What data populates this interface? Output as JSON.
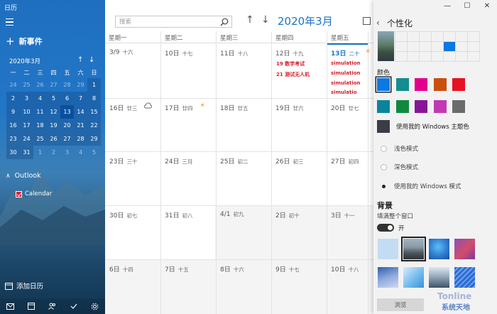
{
  "app": {
    "title": "日历"
  },
  "sidebar": {
    "new_event": "新事件",
    "mini": {
      "month_label": "2020年3月",
      "weekdays": [
        "一",
        "二",
        "三",
        "四",
        "五",
        "六",
        "日"
      ],
      "days": [
        "24",
        "25",
        "26",
        "27",
        "28",
        "29",
        "1",
        "2",
        "3",
        "4",
        "5",
        "6",
        "7",
        "8",
        "9",
        "10",
        "11",
        "12",
        "13",
        "14",
        "15",
        "16",
        "17",
        "18",
        "19",
        "20",
        "21",
        "22",
        "23",
        "24",
        "25",
        "26",
        "27",
        "28",
        "29",
        "30",
        "31",
        "1",
        "2",
        "3",
        "4",
        "5"
      ]
    },
    "outlook_label": "Outlook",
    "calendar_item": "Calendar",
    "add_calendar": "添加日历"
  },
  "toolbar": {
    "search_placeholder": "搜索",
    "month_title": "2020年3月"
  },
  "calendar": {
    "weekdays": [
      "星期一",
      "星期二",
      "星期三",
      "星期四",
      "星期五"
    ],
    "rows": [
      [
        {
          "d": "3/9",
          "l": "十六"
        },
        {
          "d": "10日",
          "l": "十七"
        },
        {
          "d": "11日",
          "l": "十八"
        },
        {
          "d": "12日",
          "l": "十九"
        },
        {
          "d": "13日",
          "l": "二十"
        }
      ],
      [
        {
          "d": "16日",
          "l": "廿三"
        },
        {
          "d": "17日",
          "l": "廿四"
        },
        {
          "d": "18日",
          "l": "廿五"
        },
        {
          "d": "19日",
          "l": "廿六"
        },
        {
          "d": "20日",
          "l": "廿七"
        }
      ],
      [
        {
          "d": "23日",
          "l": "三十"
        },
        {
          "d": "24日",
          "l": "三月"
        },
        {
          "d": "25日",
          "l": "初二"
        },
        {
          "d": "26日",
          "l": "初三"
        },
        {
          "d": "27日",
          "l": "初四"
        }
      ],
      [
        {
          "d": "30日",
          "l": "初七"
        },
        {
          "d": "31日",
          "l": "初八"
        },
        {
          "d": "4/1",
          "l": "初九"
        },
        {
          "d": "2日",
          "l": "初十"
        },
        {
          "d": "3日",
          "l": "十一"
        }
      ],
      [
        {
          "d": "6日",
          "l": "十四"
        },
        {
          "d": "7日",
          "l": "十五"
        },
        {
          "d": "8日",
          "l": "十六"
        },
        {
          "d": "9日",
          "l": "十七"
        },
        {
          "d": "10日",
          "l": "十八"
        }
      ]
    ],
    "events_thu": [
      "19 数学考试",
      "21 测试无人机"
    ],
    "events_fri": [
      "simulation",
      "simulation",
      "simulation",
      "simulatio"
    ]
  },
  "panel": {
    "title": "个性化",
    "color_label": "颜色",
    "colors_row1": [
      "#0b78e3",
      "#138d8f",
      "#e3008c",
      "#ca5010",
      "#e81123"
    ],
    "colors_row2": [
      "#0b849b",
      "#10893e",
      "#881798",
      "#c239b3",
      "#6b6b6b"
    ],
    "use_windows_theme_color": "使用我的 Windows 主题色",
    "light_mode": "浅色模式",
    "dark_mode": "深色模式",
    "use_windows_mode": "使用我的 Windows 模式",
    "background_title": "背景",
    "fill_window": "填满整个窗口",
    "toggle_label": "开",
    "browse": "浏览"
  },
  "watermark": {
    "line1": "Tonline",
    "line2": "系统天地"
  }
}
